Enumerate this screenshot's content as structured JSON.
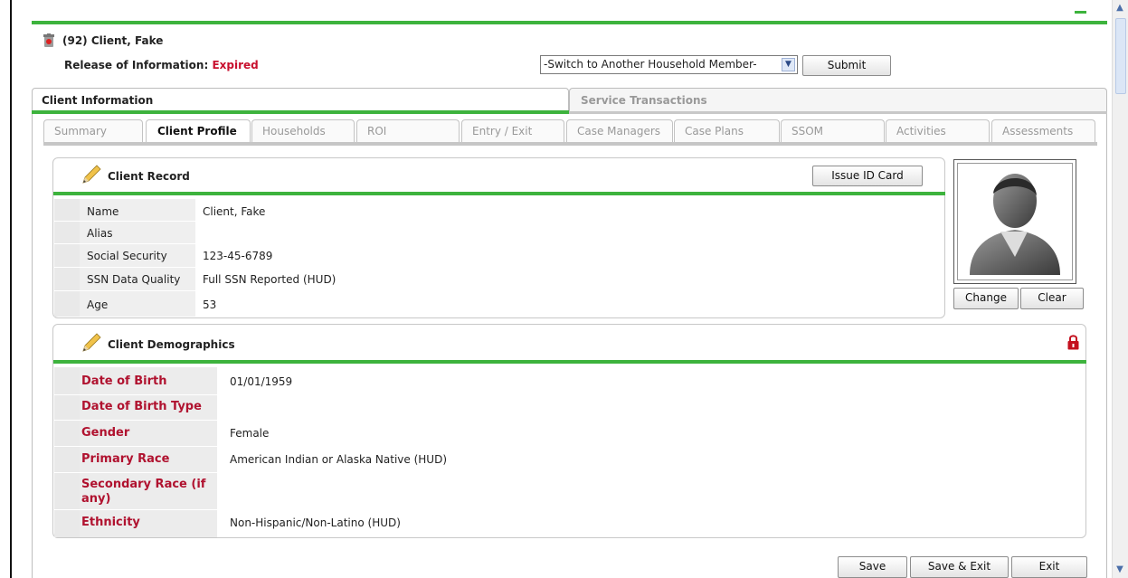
{
  "header": {
    "client_title": "(92) Client, Fake",
    "roi_label": "Release of Information:",
    "roi_status": "Expired",
    "switch_member": "-Switch to Another Household Member-",
    "submit_label": "Submit"
  },
  "main_tabs": [
    "Client Information",
    "Service Transactions"
  ],
  "sub_tabs": [
    "Summary",
    "Client Profile",
    "Households",
    "ROI",
    "Entry / Exit",
    "Case Managers",
    "Case Plans",
    "SSOM",
    "Activities",
    "Assessments"
  ],
  "client_record": {
    "title": "Client Record",
    "issue_id_card": "Issue ID Card",
    "rows": [
      {
        "label": "Name",
        "value": "Client, Fake"
      },
      {
        "label": "Alias",
        "value": ""
      },
      {
        "label": "Social Security",
        "value": "123-45-6789"
      },
      {
        "label": "SSN Data Quality",
        "value": "Full SSN Reported (HUD)"
      },
      {
        "label": "Age",
        "value": "53"
      }
    ]
  },
  "photo": {
    "change_label": "Change",
    "clear_label": "Clear"
  },
  "demographics": {
    "title": "Client Demographics",
    "rows": [
      {
        "label": "Date of Birth",
        "value": "01/01/1959"
      },
      {
        "label": "Date of Birth Type",
        "value": ""
      },
      {
        "label": "Gender",
        "value": "Female"
      },
      {
        "label": "Primary Race",
        "value": "American Indian or Alaska Native (HUD)"
      },
      {
        "label": "Secondary Race (if any)",
        "value": ""
      },
      {
        "label": "Ethnicity",
        "value": "Non-Hispanic/Non-Latino (HUD)"
      }
    ]
  },
  "footer": {
    "save": "Save",
    "save_exit": "Save & Exit",
    "exit": "Exit"
  },
  "colors": {
    "accent_green": "#3db33d",
    "label_red": "#b0122f"
  }
}
